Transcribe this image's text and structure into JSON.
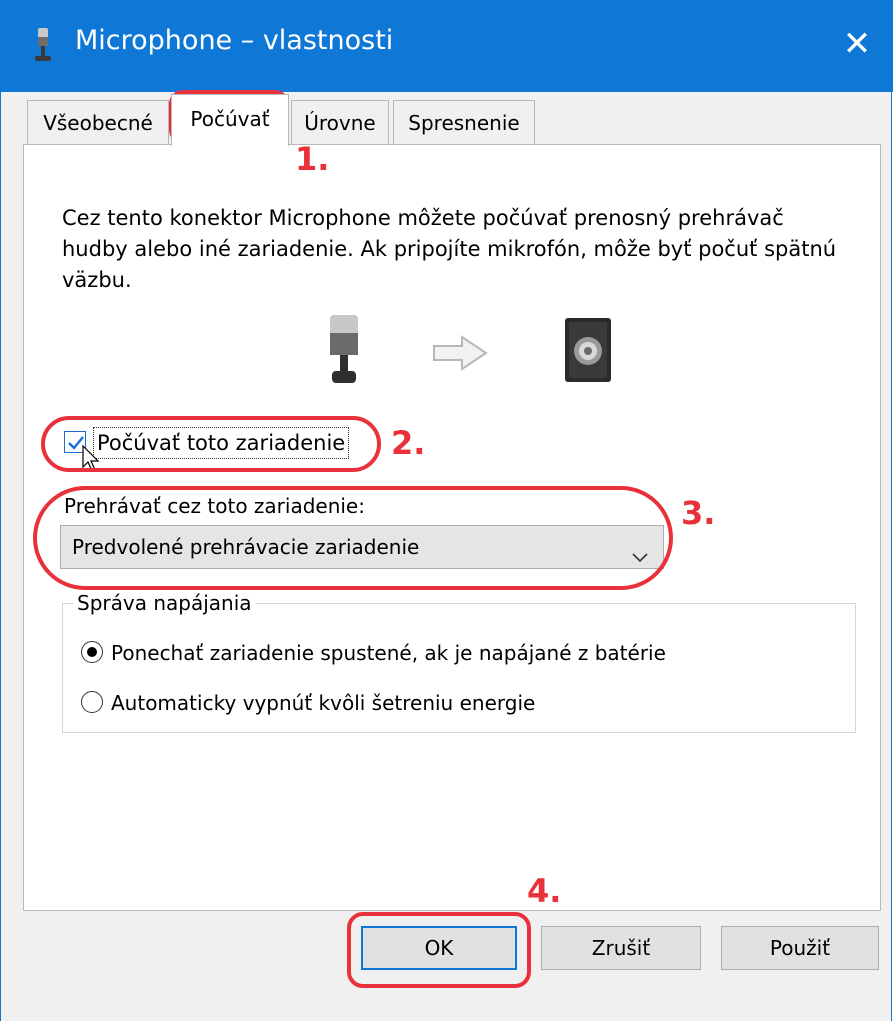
{
  "window": {
    "title": "Microphone – vlastnosti",
    "close_glyph": "✕"
  },
  "tabs": [
    {
      "label": "Všeobecné"
    },
    {
      "label": "Počúvať",
      "active": true
    },
    {
      "label": "Úrovne"
    },
    {
      "label": "Spresnenie"
    }
  ],
  "listen": {
    "description": "Cez tento konektor Microphone môžete počúvať prenosný prehrávač hudby alebo iné zariadenie. Ak pripojíte mikrofón, môže byť počuť spätnú väzbu.",
    "listen_checkbox_label": "Počúvať toto zariadenie",
    "listen_checked": true,
    "playback_label": "Prehrávať cez toto zariadenie:",
    "playback_selected": "Predvolené prehrávacie zariadenie"
  },
  "power": {
    "group_title": "Správa napájania",
    "options": [
      {
        "label": "Ponechať zariadenie spustené, ak je napájané z batérie",
        "selected": true
      },
      {
        "label": "Automaticky vypnúť kvôli šetreniu energie",
        "selected": false
      }
    ]
  },
  "buttons": {
    "ok": "OK",
    "cancel": "Zrušiť",
    "apply": "Použiť"
  },
  "annotations": [
    "1.",
    "2.",
    "3.",
    "4."
  ],
  "colors": {
    "titlebar": "#0f78d7",
    "annotation": "#e8313a"
  },
  "icons": [
    "microphone-icon",
    "arrow-right-icon",
    "speaker-icon",
    "close-icon",
    "chevron-down-icon"
  ]
}
